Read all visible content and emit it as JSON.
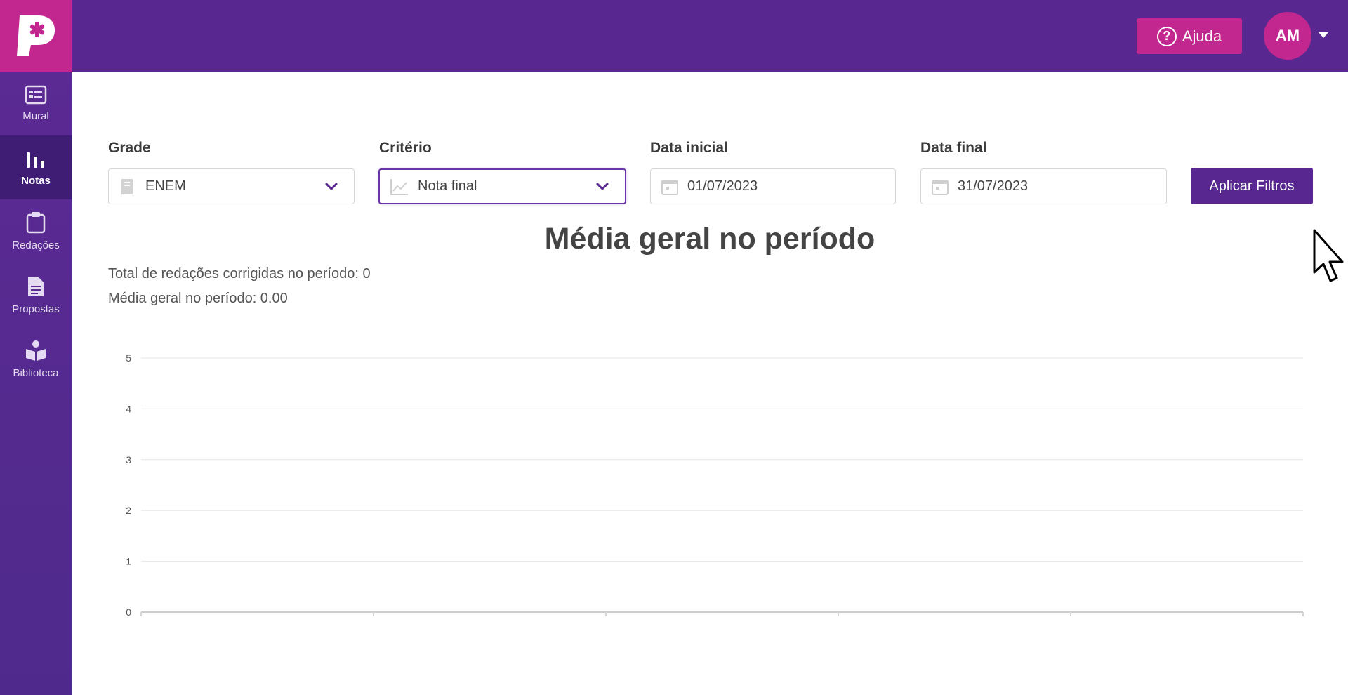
{
  "header": {
    "logo_letter": "P",
    "help_label": "Ajuda",
    "avatar_initials": "AM"
  },
  "sidebar": {
    "items": [
      {
        "label": "Mural",
        "icon": "board-icon",
        "active": false
      },
      {
        "label": "Notas",
        "icon": "bar-chart-icon",
        "active": true
      },
      {
        "label": "Redações",
        "icon": "clipboard-icon",
        "active": false
      },
      {
        "label": "Propostas",
        "icon": "document-icon",
        "active": false
      },
      {
        "label": "Biblioteca",
        "icon": "book-reader-icon",
        "active": false
      }
    ]
  },
  "filters": {
    "grade": {
      "label": "Grade",
      "value": "ENEM",
      "icon": "book-icon"
    },
    "criterio": {
      "label": "Critério",
      "value": "Nota final",
      "icon": "line-chart-icon"
    },
    "data_inicial": {
      "label": "Data inicial",
      "value": "01/07/2023",
      "icon": "calendar-icon"
    },
    "data_final": {
      "label": "Data final",
      "value": "31/07/2023",
      "icon": "calendar-icon"
    },
    "apply_label": "Aplicar Filtros"
  },
  "summary": {
    "title": "Média geral no período",
    "total_text": "Total de redações corrigidas no período: 0",
    "media_text": "Média geral no período: 0.00"
  },
  "colors": {
    "primary": "#582890",
    "accent": "#c2268f",
    "sidebar_active": "#3f1d74"
  },
  "chart_data": {
    "type": "line",
    "title": "",
    "xlabel": "",
    "ylabel": "",
    "ylim": [
      0,
      5
    ],
    "y_ticks": [
      0,
      1,
      2,
      3,
      4,
      5
    ],
    "x_ticks": [
      ""
    ],
    "series": [],
    "grid": true
  }
}
